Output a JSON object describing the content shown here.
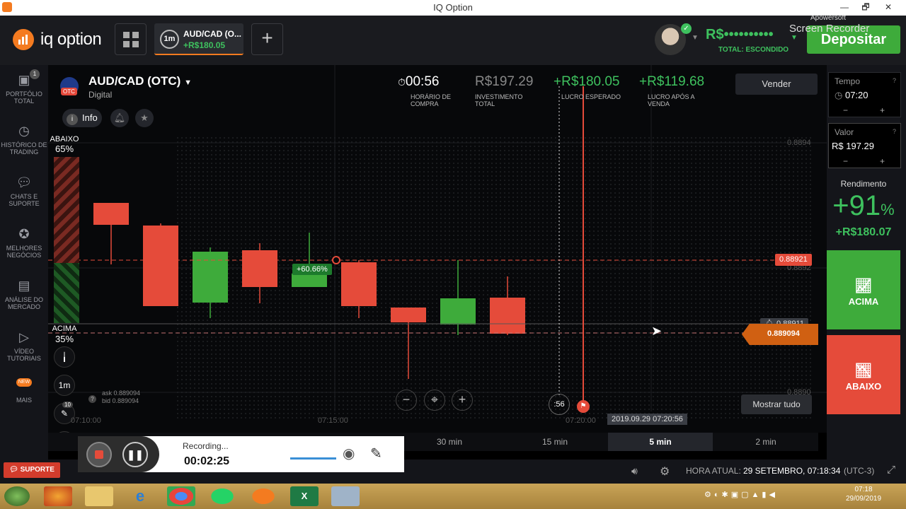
{
  "window": {
    "title": "IQ Option",
    "controls": [
      "—",
      "🗗",
      "✕"
    ]
  },
  "header": {
    "logo_text": "iq option",
    "asset_tab": {
      "timeframe": "1m",
      "name": "AUD/CAD (O...",
      "profit": "+R$180.05"
    },
    "plus_label": "+",
    "balance": "R$••••••••••",
    "balance_sub": "TOTAL: ESCONDIDO",
    "deposit_label": "Depositar",
    "watermark_line1": "Apowersoft",
    "watermark_line2": "Screen Recorder"
  },
  "sidebar": {
    "items": [
      {
        "label": "PORTFÓLIO TOTAL",
        "icon": "briefcase-icon",
        "badge": "1"
      },
      {
        "label": "HISTÓRICO DE TRADING",
        "icon": "history-icon"
      },
      {
        "label": "CHATS E SUPORTE",
        "icon": "chat-icon"
      },
      {
        "label": "MELHORES NEGÓCIOS",
        "icon": "trophy-icon"
      },
      {
        "label": "ANÁLISE DO MERCADO",
        "icon": "news-icon"
      },
      {
        "label": "VÍDEO TUTORIAIS",
        "icon": "play-icon"
      },
      {
        "label": "MAIS",
        "icon": "more-icon",
        "badge": "NEW"
      }
    ]
  },
  "asset": {
    "name": "AUD/CAD (OTC)",
    "type": "Digital",
    "otc_badge": "OTC",
    "info_label": "Info"
  },
  "sentiment": {
    "down_label": "ABAIXO",
    "down_pct": "65%",
    "up_label": "ACIMA",
    "up_pct": "35%"
  },
  "trade_header": {
    "timer": "00:56",
    "timer_label": "HORÁRIO DE COMPRA",
    "investment": "R$197.29",
    "investment_label": "INVESTIMENTO TOTAL",
    "expected": "+R$180.05",
    "expected_label": "LUCRO ESPERADO",
    "after_sale": "+R$119.68",
    "after_sale_label": "LUCRO APÓS A VENDA",
    "sell_label": "Vender"
  },
  "chart_data": {
    "type": "candlestick",
    "asset": "AUD/CAD (OTC)",
    "y_ticks": [
      "0.8894",
      "0.8892",
      "0.8890"
    ],
    "x_ticks": [
      "07:10:00",
      "07:15:00",
      "07:20:00"
    ],
    "candles": [
      {
        "dir": "down",
        "label": "1"
      },
      {
        "dir": "down",
        "label": "2"
      },
      {
        "dir": "up",
        "label": "3"
      },
      {
        "dir": "down",
        "label": "4"
      },
      {
        "dir": "up",
        "label": "5"
      },
      {
        "dir": "down",
        "label": "6"
      },
      {
        "dir": "down",
        "label": "7"
      },
      {
        "dir": "up",
        "label": "8"
      },
      {
        "dir": "down",
        "label": "9"
      }
    ],
    "entry_price": "0.88921",
    "current_price": "0.88911",
    "live_price": "0.889094",
    "entry_percent": "+60.66%",
    "countdown": ":56",
    "ask": "ask 0.889094",
    "bid": "bid 0.889094",
    "date_marker": "2019.09.29 07:20:56",
    "show_all_label": "Mostrar tudo",
    "tool_1m": "1m",
    "tool_badge": "10"
  },
  "timeframes": [
    {
      "label": "30 min",
      "active": false
    },
    {
      "label": "15 min",
      "active": false
    },
    {
      "label": "5 min",
      "active": true
    },
    {
      "label": "2 min",
      "active": false
    }
  ],
  "right_panel": {
    "time_label": "Tempo",
    "time_value": "07:20",
    "value_label": "Valor",
    "value_value": "R$ 197.29",
    "yield_label": "Rendimento",
    "yield_pct": "+91",
    "yield_pct_sign": "%",
    "yield_amount": "+R$180.07",
    "up_label": "ACIMA",
    "down_label": "ABAIXO",
    "minus": "−",
    "plus": "+"
  },
  "recorder": {
    "status": "Recording...",
    "time": "00:02:25"
  },
  "status_bar": {
    "support_label": "SUPORTE",
    "clock_label": "HORA ATUAL:",
    "clock_value": "29 SETEMBRO, 07:18:34",
    "tz": "(UTC-3)"
  },
  "taskbar": {
    "time": "07:18",
    "date": "29/09/2019"
  },
  "colors": {
    "green": "#3eab3b",
    "red": "#e54b3a",
    "orange": "#f47b20",
    "bg": "#07080a"
  }
}
